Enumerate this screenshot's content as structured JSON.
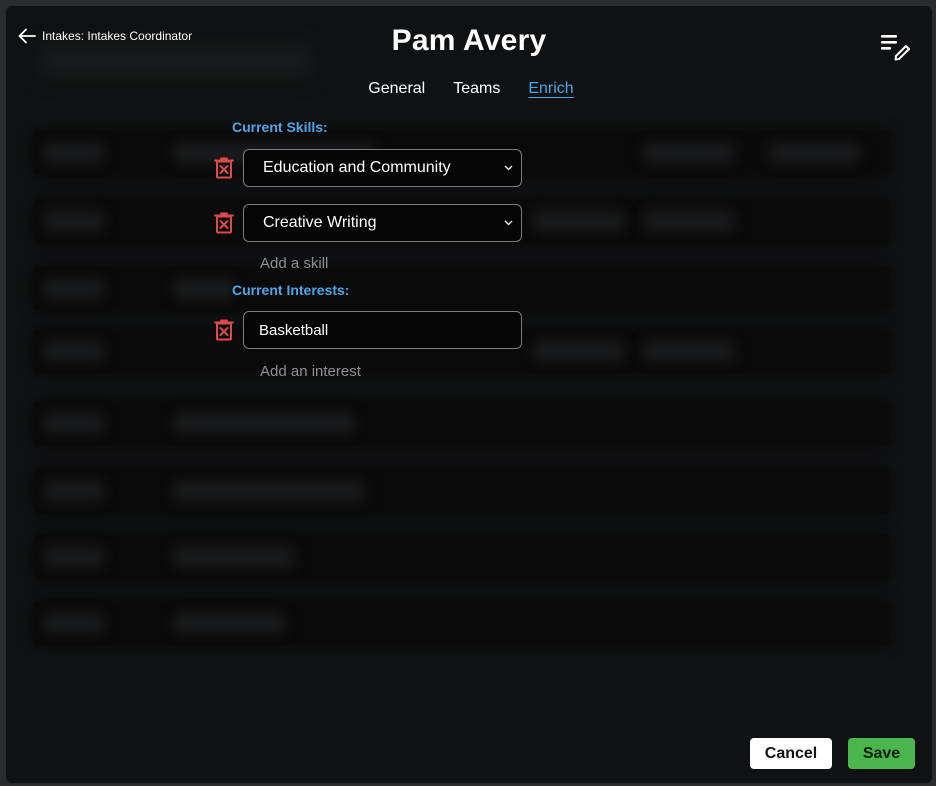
{
  "header": {
    "back_label": "Intakes: Intakes Coordinator",
    "title": "Pam Avery"
  },
  "tabs": [
    {
      "label": "General",
      "active": false
    },
    {
      "label": "Teams",
      "active": false
    },
    {
      "label": "Enrich",
      "active": true
    }
  ],
  "skills": {
    "label": "Current Skills:",
    "items": [
      {
        "value": "Education and Community"
      },
      {
        "value": "Creative Writing"
      }
    ],
    "add_label": "Add a skill"
  },
  "interests": {
    "label": "Current Interests:",
    "items": [
      {
        "value": "Basketball"
      }
    ],
    "add_label": "Add an interest"
  },
  "footer": {
    "cancel_label": "Cancel",
    "save_label": "Save"
  },
  "colors": {
    "accent": "#4da6e9",
    "delete": "#e14a4a",
    "save": "#4bb54e"
  }
}
